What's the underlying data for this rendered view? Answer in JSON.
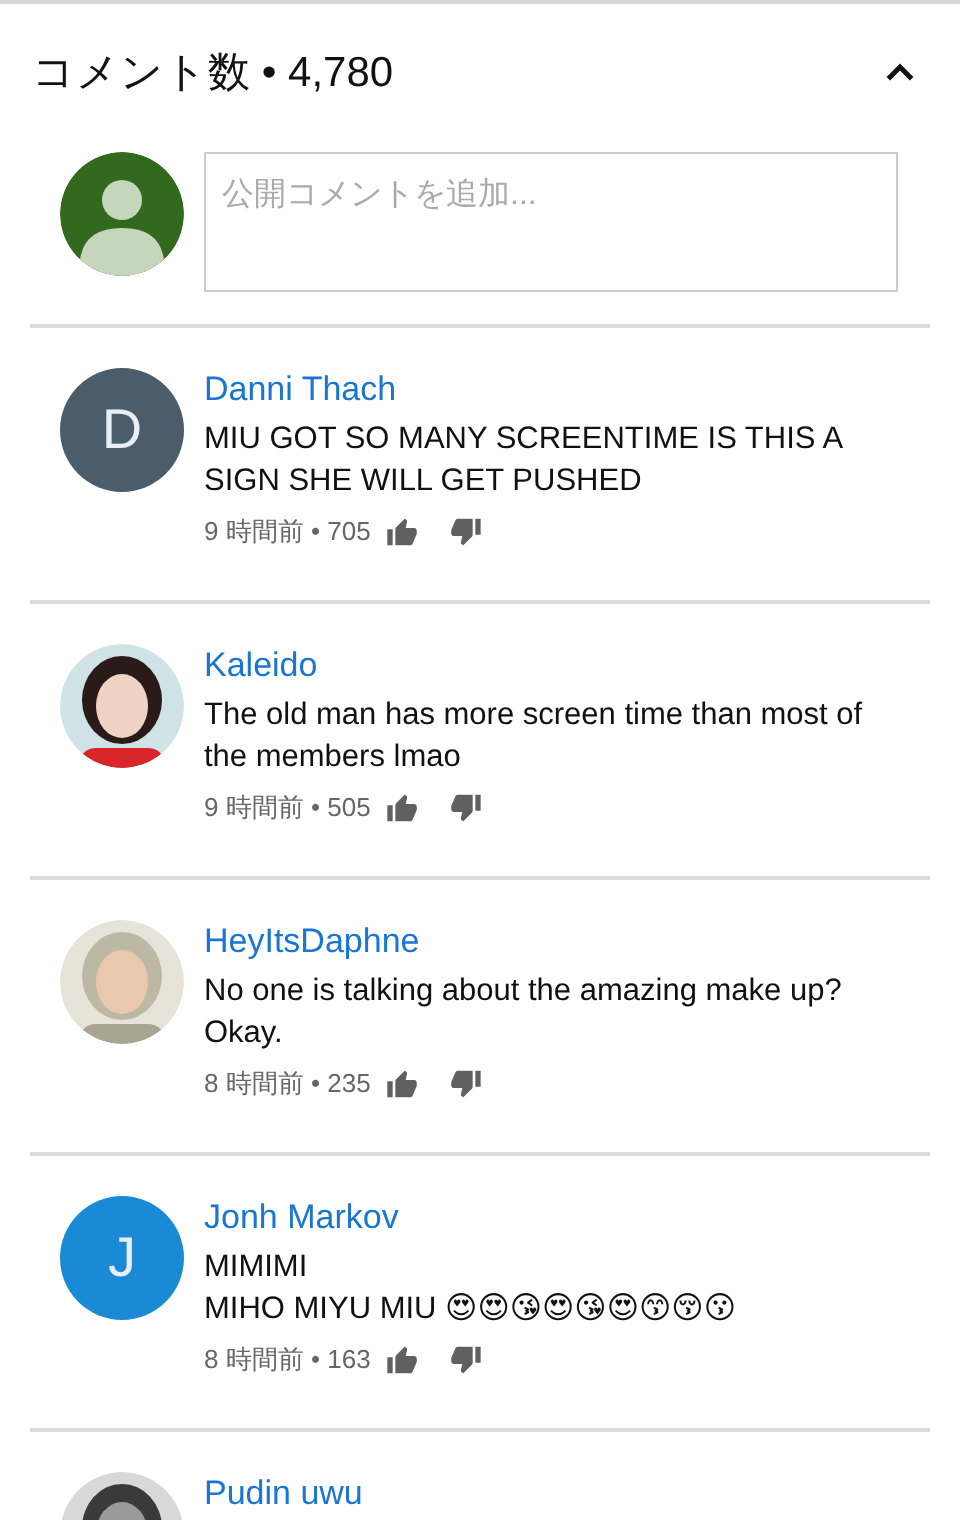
{
  "header": {
    "title": "コメント数 • 4,780",
    "expanded": true
  },
  "composer": {
    "placeholder": "公開コメントを追加..."
  },
  "comments": [
    {
      "author": "Danni Thach",
      "avatar": {
        "kind": "letter",
        "letter": "D",
        "color": "#4b5d6a"
      },
      "text": "MIU GOT SO MANY SCREENTIME IS THIS A SIGN SHE WILL GET PUSHED",
      "meta": "9 時間前 • 705"
    },
    {
      "author": "Kaleido",
      "text": "The old man has more screen time than most of the members lmao",
      "meta": "9 時間前 • 505"
    },
    {
      "author": "HeyItsDaphne",
      "text": "No one is talking about the amazing make up? Okay.",
      "meta": "8 時間前 • 235"
    },
    {
      "author": "Jonh Markov",
      "avatar": {
        "kind": "letter",
        "letter": "J",
        "color": "#1a8ad6"
      },
      "text": "MIMIMI\nMIHO MIYU MIU 😍😍😘😍😘😍😙😚😗",
      "meta": "8 時間前 • 163"
    },
    {
      "author": "Pudin uwu"
    }
  ]
}
